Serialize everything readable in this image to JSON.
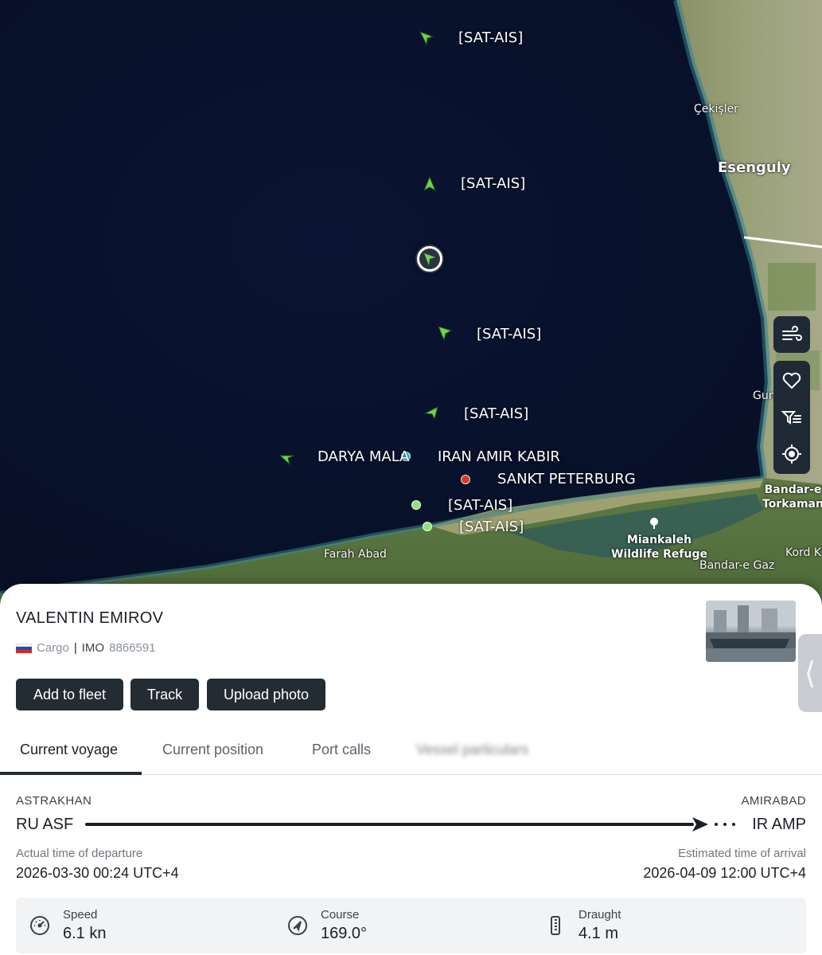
{
  "map": {
    "vessel_labels": [
      {
        "id": "sat1",
        "text": "[SAT-AIS]"
      },
      {
        "id": "sat2",
        "text": "[SAT-AIS]"
      },
      {
        "id": "sat3",
        "text": "[SAT-AIS]"
      },
      {
        "id": "sat4",
        "text": "[SAT-AIS]"
      },
      {
        "id": "darya",
        "text": "DARYA MALA"
      },
      {
        "id": "iran",
        "text": "IRAN AMIR KABIR"
      },
      {
        "id": "sankt",
        "text": "SANKT PETERBURG"
      },
      {
        "id": "sat5",
        "text": "[SAT-AIS]"
      },
      {
        "id": "sat6",
        "text": "[SAT-AIS]"
      }
    ],
    "places": {
      "cekisler": "Çekişler",
      "esenguly": "Esenguly",
      "gun": "Gun",
      "bandar_torkaman_1": "Bandar-e",
      "bandar_torkaman_2": "Torkaman",
      "miankaleh_1": "Miankaleh",
      "miankaleh_2": "Wildlife Refuge",
      "farah_abad": "Farah Abad",
      "bandar_gaz": "Bandar-e Gaz",
      "kord": "Kord K"
    },
    "colors": {
      "sea": "#08112a",
      "land": "#6f7a4e",
      "vessel_green": "#6fd44a",
      "dot_cyan": "#3cc8e8",
      "dot_red": "#e0352b",
      "dot_green": "#8fe07a"
    },
    "controls": [
      "wind-icon",
      "heart-icon",
      "filter-icon",
      "locate-icon"
    ]
  },
  "vessel": {
    "name": "VALENTIN EMIROV",
    "type": "Cargo",
    "separator": "|",
    "imo_label": "IMO",
    "imo": "8866591",
    "flag": "russia-flag"
  },
  "actions": {
    "add_to_fleet": "Add to fleet",
    "track": "Track",
    "upload_photo": "Upload photo"
  },
  "tabs": {
    "current_voyage": "Current voyage",
    "current_position": "Current position",
    "port_calls": "Port calls",
    "hidden": "Vessel particulars"
  },
  "voyage": {
    "origin_name": "ASTRAKHAN",
    "origin_code": "RU ASF",
    "destination_name": "AMIRABAD",
    "destination_code": "IR AMP",
    "departure_label": "Actual time of departure",
    "departure_time": "2026-03-30 00:24 UTC+4",
    "arrival_label": "Estimated time of arrival",
    "arrival_time": "2026-04-09 12:00 UTC+4"
  },
  "stats": {
    "speed_label": "Speed",
    "speed_value": "6.1 kn",
    "course_label": "Course",
    "course_value": "169.0°",
    "draught_label": "Draught",
    "draught_value": "4.1 m"
  }
}
